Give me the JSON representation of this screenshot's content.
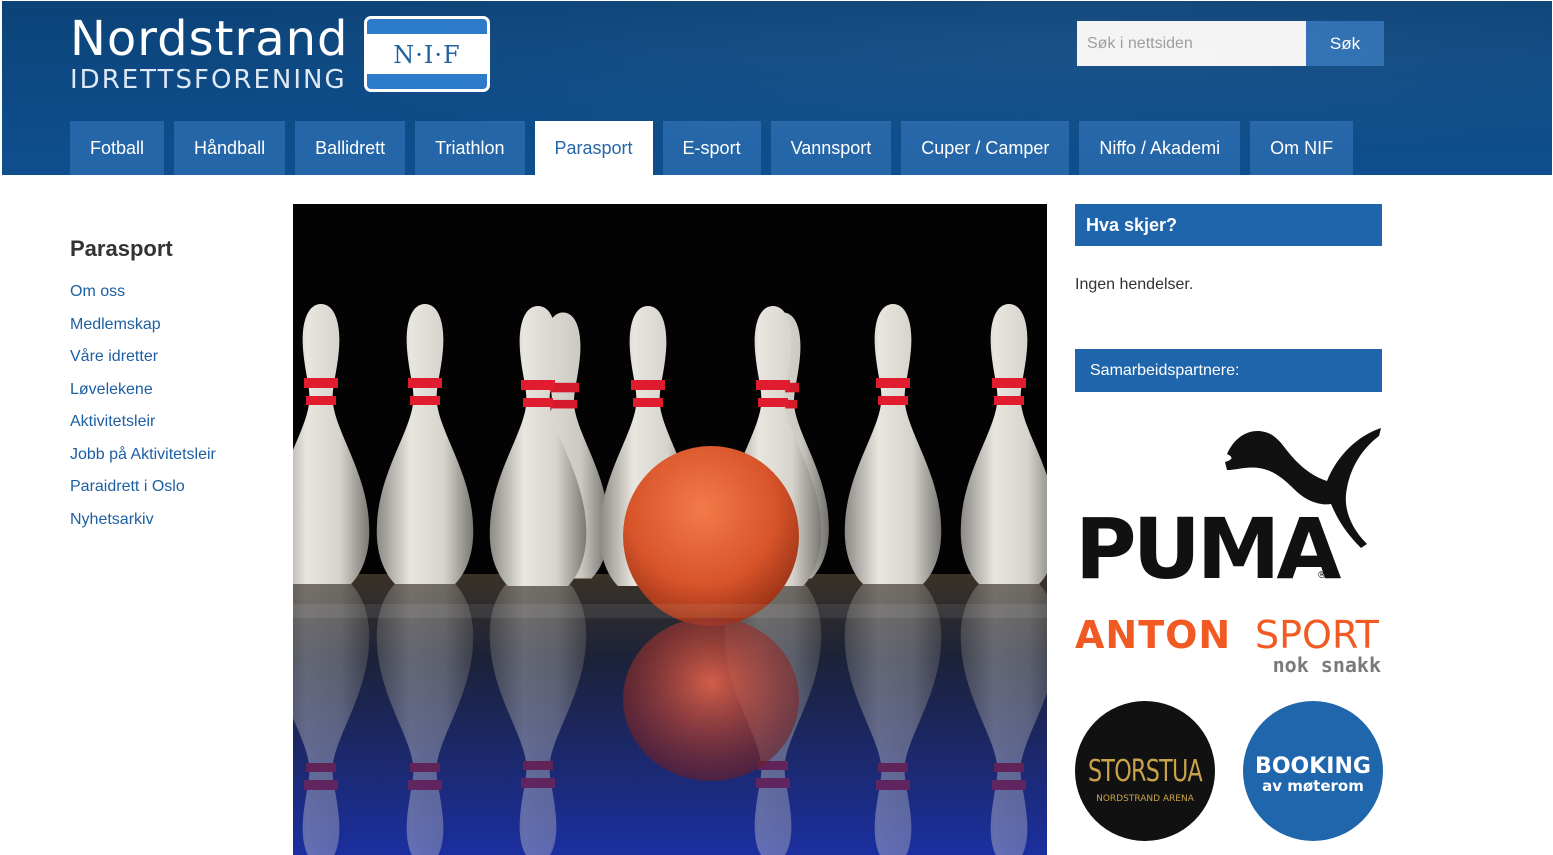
{
  "header": {
    "logo_line1": "Nordstrand",
    "logo_line2": "IDRETTSFORENING",
    "badge_text": "N·I·F",
    "search_placeholder": "Søk i nettsiden",
    "search_button": "Søk"
  },
  "nav": {
    "items": [
      "Fotball",
      "Håndball",
      "Ballidrett",
      "Triathlon",
      "Parasport",
      "E-sport",
      "Vannsport",
      "Cuper / Camper",
      "Niffo / Akademi",
      "Om NIF"
    ],
    "active": "Parasport"
  },
  "sidebar": {
    "title": "Parasport",
    "items": [
      "Om oss",
      "Medlemskap",
      "Våre idretter",
      "Løvelekene",
      "Aktivitetsleir",
      "Jobb på Aktivitetsleir",
      "Paraidrett i Oslo",
      "Nyhetsarkiv"
    ]
  },
  "events": {
    "title": "Hva skjer?",
    "empty_text": "Ingen hendelser."
  },
  "partners": {
    "title": "Samarbeidspartnere:",
    "puma": "PUMA",
    "anton_1": "ANTON",
    "anton_2": "SPORT",
    "anton_tagline": "nok snakk",
    "storstua": "STORSTUA",
    "storstua_sub": "NORDSTRAND ARENA",
    "booking_1": "BOOKING",
    "booking_2": "av møterom"
  },
  "colors": {
    "header_bg": "#0d4a86",
    "nav_bg": "#2566a8",
    "link": "#1d5fa3",
    "box_header": "#1f65ab",
    "anton_orange": "#f15a22"
  }
}
